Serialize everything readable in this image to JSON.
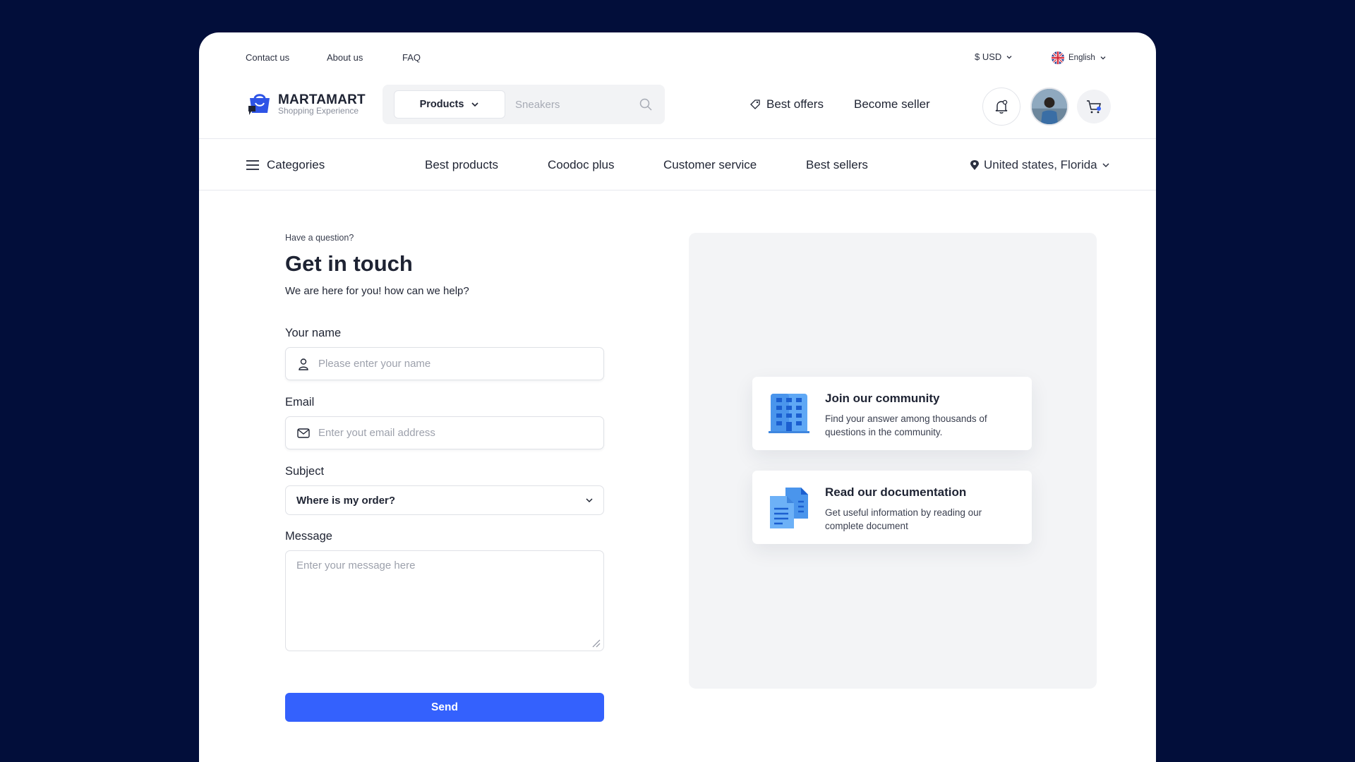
{
  "topbar": {
    "links": [
      "Contact us",
      "About us",
      "FAQ"
    ],
    "currency": "$ USD",
    "language": "English"
  },
  "logo": {
    "name": "MARTAMART",
    "tagline": "Shopping Experience"
  },
  "search": {
    "category": "Products",
    "placeholder": "Sneakers"
  },
  "header": {
    "offers": "Best offers",
    "seller": "Become seller"
  },
  "nav": {
    "categories": "Categories",
    "items": [
      "Best products",
      "Coodoc plus",
      "Customer service",
      "Best sellers"
    ],
    "location": "United states, Florida"
  },
  "form": {
    "eyebrow": "Have a question?",
    "title": "Get in touch",
    "subtitle": "We are here for you! how can we help?",
    "name_label": "Your name",
    "name_placeholder": "Please enter your name",
    "email_label": "Email",
    "email_placeholder": "Enter yout email address",
    "subject_label": "Subject",
    "subject_value": "Where is my order?",
    "message_label": "Message",
    "message_placeholder": "Enter your message here",
    "send": "Send"
  },
  "cards": [
    {
      "title": "Join our community",
      "desc": "Find your answer among thousands of questions in the community.",
      "icon": "building-icon"
    },
    {
      "title": "Read our documentation",
      "desc": "Get useful information by reading our complete document",
      "icon": "documents-icon"
    }
  ],
  "colors": {
    "background": "#020e3a",
    "primary": "#3461fd",
    "panel": "#f3f4f6"
  }
}
